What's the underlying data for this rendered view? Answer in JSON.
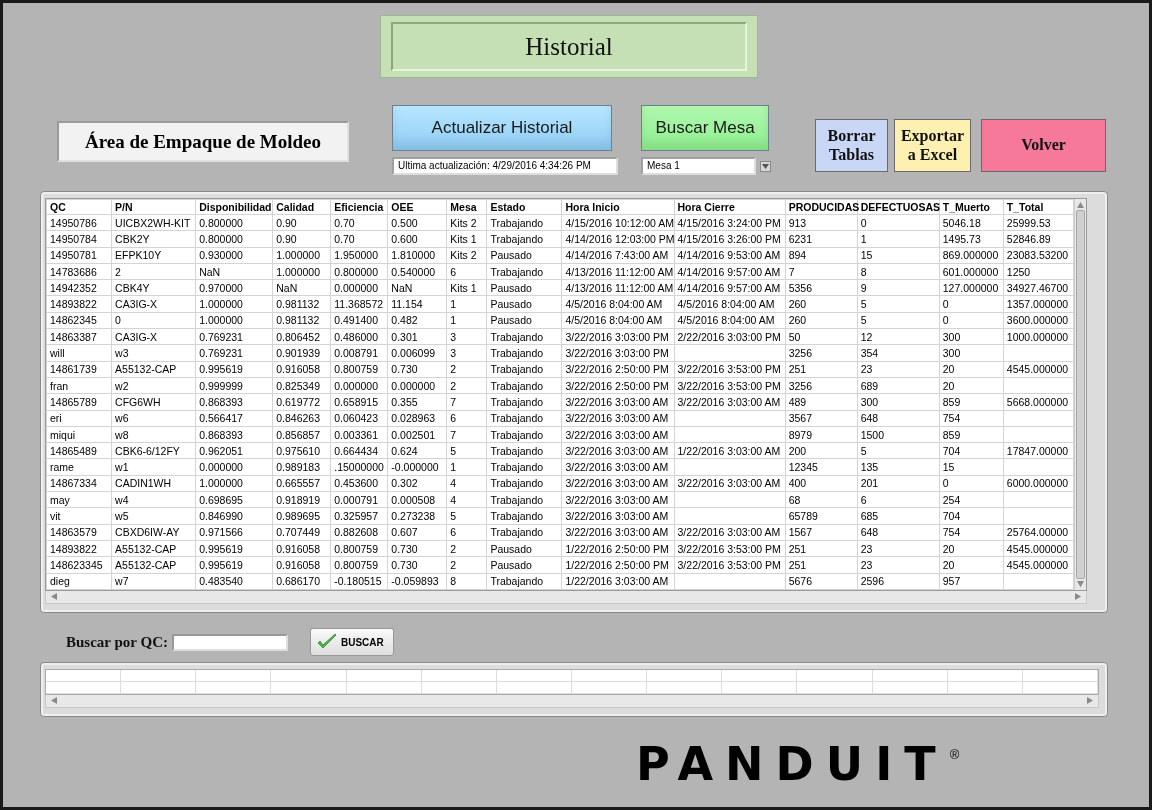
{
  "title": "Historial",
  "area_label": "Área de Empaque de Moldeo",
  "buttons": {
    "actualizar": "Actualizar Historial",
    "buscar_mesa": "Buscar Mesa",
    "borrar": "Borrar Tablas",
    "exportar": "Exportar a Excel",
    "volver": "Volver"
  },
  "last_update": "Ultima actualización: 4/29/2016 4:34:26 PM",
  "mesa_select": {
    "value": "Mesa 1"
  },
  "table": {
    "columns": [
      "QC",
      "P/N",
      "Disponibilidad",
      "Calidad",
      "Eficiencia",
      "OEE",
      "Mesa",
      "Estado",
      "Hora Inicio",
      "Hora Cierre",
      "PRODUCIDAS",
      "DEFECTUOSAS",
      "T_Muerto",
      "T_Total"
    ],
    "rows": [
      [
        "14950786",
        "UICBX2WH-KIT",
        "0.800000",
        "0.90",
        "0.70",
        "0.500",
        "Kits 2",
        "Trabajando",
        "4/15/2016 10:12:00 AM",
        "4/15/2016 3:24:00 PM",
        "913",
        "0",
        "5046.18",
        "25999.53"
      ],
      [
        "14950784",
        "CBK2Y",
        "0.800000",
        "0.90",
        "0.70",
        "0.600",
        "Kits 1",
        "Trabajando",
        "4/14/2016 12:03:00 PM",
        "4/15/2016 3:26:00 PM",
        "6231",
        "1",
        "1495.73",
        "52846.89"
      ],
      [
        "14950781",
        "EFPK10Y",
        "0.930000",
        "1.000000",
        "1.950000",
        "1.810000",
        "Kits 2",
        "Pausado",
        "4/14/2016 7:43:00 AM",
        "4/14/2016 9:53:00 AM",
        "894",
        "15",
        "869.000000",
        "23083.53200"
      ],
      [
        "14783686",
        "2",
        "NaN",
        "1.000000",
        "0.800000",
        "0.540000",
        "6",
        "Trabajando",
        "4/13/2016 11:12:00 AM",
        "4/14/2016 9:57:00 AM",
        "7",
        "8",
        "601.000000",
        "1250"
      ],
      [
        "14942352",
        "CBK4Y",
        "0.970000",
        "NaN",
        "0.000000",
        "NaN",
        "Kits 1",
        "Pausado",
        "4/13/2016 11:12:00 AM",
        "4/14/2016 9:57:00 AM",
        "5356",
        "9",
        "127.000000",
        "34927.46700"
      ],
      [
        "14893822",
        "CA3IG-X",
        "1.000000",
        "0.981132",
        "11.368572",
        "11.154",
        "1",
        "Pausado",
        "4/5/2016 8:04:00 AM",
        "4/5/2016 8:04:00 AM",
        "260",
        "5",
        "0",
        "1357.000000"
      ],
      [
        "14862345",
        "0",
        "1.000000",
        "0.981132",
        "0.491400",
        "0.482",
        "1",
        "Pausado",
        "4/5/2016 8:04:00 AM",
        "4/5/2016 8:04:00 AM",
        "260",
        "5",
        "0",
        "3600.000000"
      ],
      [
        "14863387",
        "CA3IG-X",
        "0.769231",
        "0.806452",
        "0.486000",
        "0.301",
        "3",
        "Trabajando",
        "3/22/2016 3:03:00 PM",
        "2/22/2016 3:03:00 PM",
        "50",
        "12",
        "300",
        "1000.000000"
      ],
      [
        "will",
        "w3",
        "0.769231",
        "0.901939",
        "0.008791",
        "0.006099",
        "3",
        "Trabajando",
        "3/22/2016 3:03:00 PM",
        null,
        "3256",
        "354",
        "300",
        null
      ],
      [
        "14861739",
        "A55132-CAP",
        "0.995619",
        "0.916058",
        "0.800759",
        "0.730",
        "2",
        "Trabajando",
        "3/22/2016 2:50:00 PM",
        "3/22/2016 3:53:00 PM",
        "251",
        "23",
        "20",
        "4545.000000"
      ],
      [
        "fran",
        "w2",
        "0.999999",
        "0.825349",
        "0.000000",
        "0.000000",
        "2",
        "Trabajando",
        "3/22/2016 2:50:00 PM",
        "3/22/2016 3:53:00 PM",
        "3256",
        "689",
        "20",
        null
      ],
      [
        "14865789",
        "CFG6WH",
        "0.868393",
        "0.619772",
        "0.658915",
        "0.355",
        "7",
        "Trabajando",
        "3/22/2016 3:03:00 AM",
        "3/22/2016 3:03:00 AM",
        "489",
        "300",
        "859",
        "5668.000000"
      ],
      [
        "eri",
        "w6",
        "0.566417",
        "0.846263",
        "0.060423",
        "0.028963",
        "6",
        "Trabajando",
        "3/22/2016 3:03:00 AM",
        null,
        "3567",
        "648",
        "754",
        null
      ],
      [
        "miqui",
        "w8",
        "0.868393",
        "0.856857",
        "0.003361",
        "0.002501",
        "7",
        "Trabajando",
        "3/22/2016 3:03:00 AM",
        null,
        "8979",
        "1500",
        "859",
        null
      ],
      [
        "14865489",
        "CBK6-6/12FY",
        "0.962051",
        "0.975610",
        "0.664434",
        "0.624",
        "5",
        "Trabajando",
        "3/22/2016 3:03:00 AM",
        "1/22/2016 3:03:00 AM",
        "200",
        "5",
        "704",
        "17847.00000"
      ],
      [
        "rame",
        "w1",
        "0.000000",
        "0.989183",
        ".15000000",
        "-0.000000",
        "1",
        "Trabajando",
        "3/22/2016 3:03:00 AM",
        null,
        "12345",
        "135",
        "15",
        null
      ],
      [
        "14867334",
        "CADIN1WH",
        "1.000000",
        "0.665557",
        "0.453600",
        "0.302",
        "4",
        "Trabajando",
        "3/22/2016 3:03:00 AM",
        "3/22/2016 3:03:00 AM",
        "400",
        "201",
        "0",
        "6000.000000"
      ],
      [
        "may",
        "w4",
        "0.698695",
        "0.918919",
        "0.000791",
        "0.000508",
        "4",
        "Trabajando",
        "3/22/2016 3:03:00 AM",
        null,
        "68",
        "6",
        "254",
        null
      ],
      [
        "vit",
        "w5",
        "0.846990",
        "0.989695",
        "0.325957",
        "0.273238",
        "5",
        "Trabajando",
        "3/22/2016 3:03:00 AM",
        null,
        "65789",
        "685",
        "704",
        null
      ],
      [
        "14863579",
        "CBXD6IW-AY",
        "0.971566",
        "0.707449",
        "0.882608",
        "0.607",
        "6",
        "Trabajando",
        "3/22/2016 3:03:00 AM",
        "3/22/2016 3:03:00 AM",
        "1567",
        "648",
        "754",
        "25764.00000"
      ],
      [
        "14893822",
        "A55132-CAP",
        "0.995619",
        "0.916058",
        "0.800759",
        "0.730",
        "2",
        "Pausado",
        "1/22/2016 2:50:00 PM",
        "3/22/2016 3:53:00 PM",
        "251",
        "23",
        "20",
        "4545.000000"
      ],
      [
        "148623345",
        "A55132-CAP",
        "0.995619",
        "0.916058",
        "0.800759",
        "0.730",
        "2",
        "Pausado",
        "1/22/2016 2:50:00 PM",
        "3/22/2016 3:53:00 PM",
        "251",
        "23",
        "20",
        "4545.000000"
      ],
      [
        "dieg",
        "w7",
        "0.483540",
        "0.686170",
        "-0.180515",
        "-0.059893",
        "8",
        "Trabajando",
        "1/22/2016 3:03:00 AM",
        null,
        "5676",
        "2596",
        "957",
        null
      ]
    ]
  },
  "search": {
    "label": "Buscar por QC:",
    "button": "BUSCAR"
  },
  "logo": {
    "text": "PANDUIT",
    "mark": "®"
  }
}
